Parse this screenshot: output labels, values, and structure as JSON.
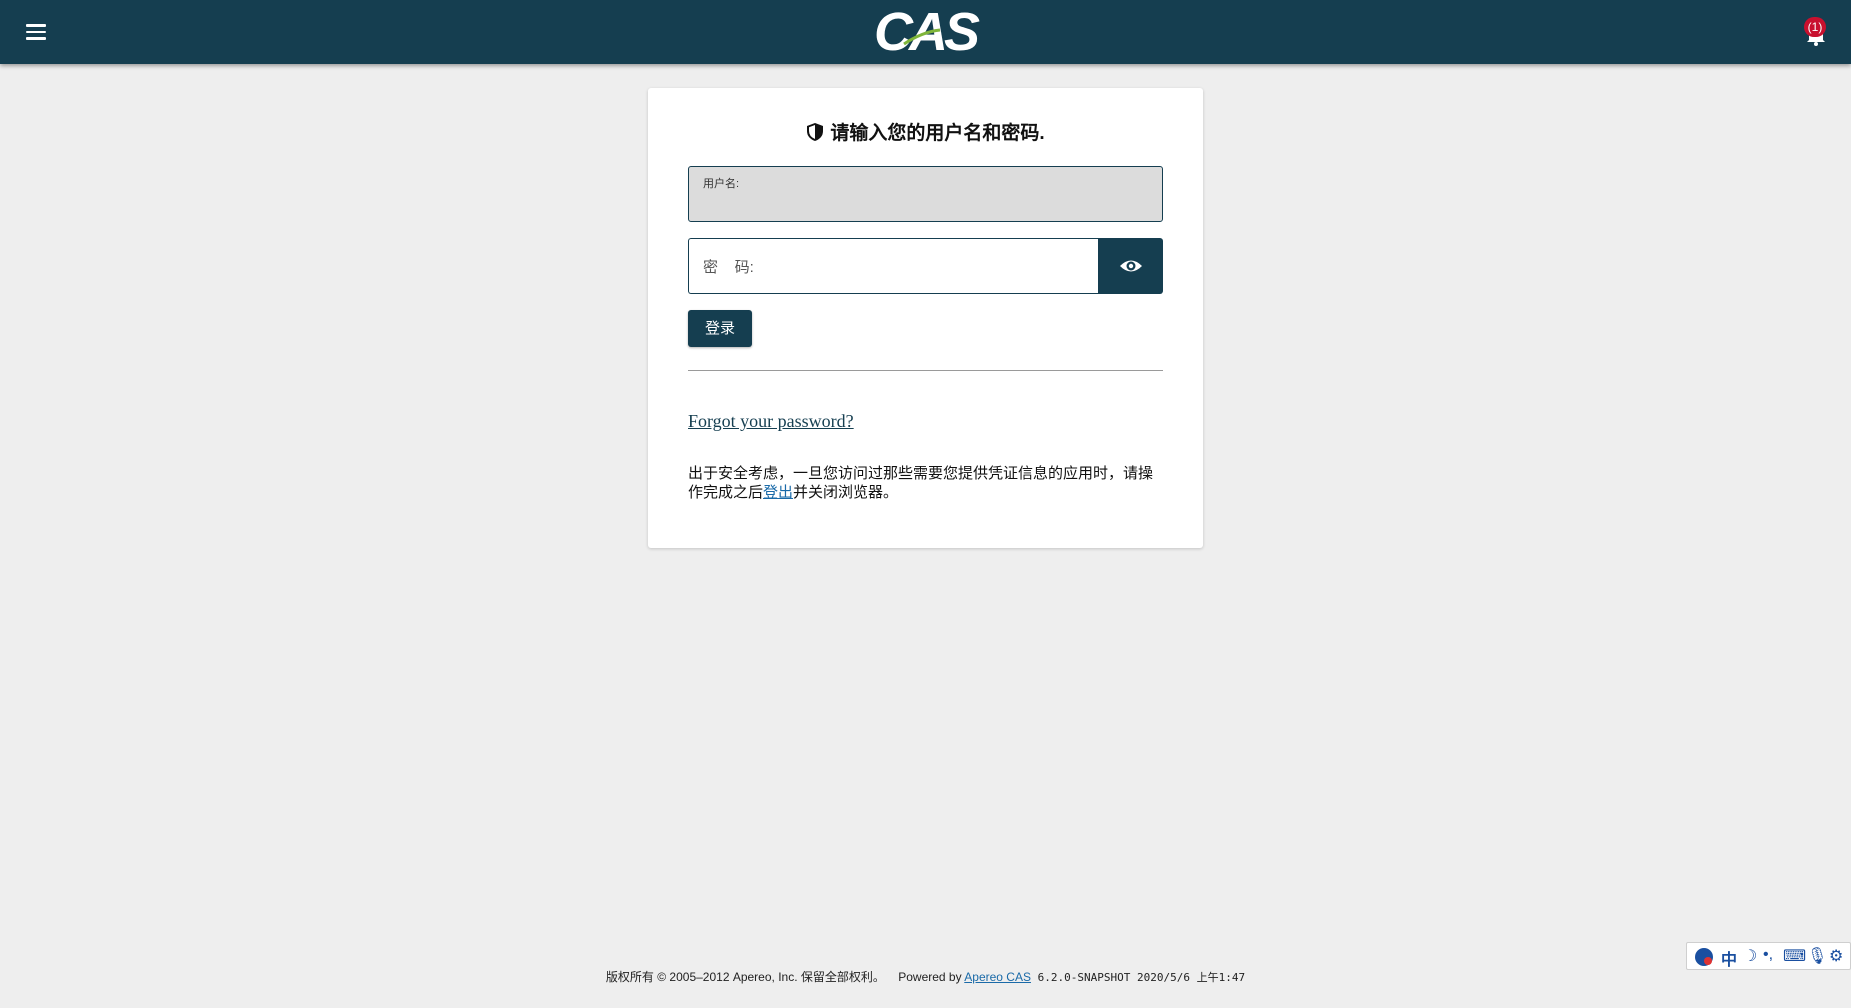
{
  "header": {
    "logo": "CAS",
    "notification_count": "(1)"
  },
  "login": {
    "heading": "请输入您的用户名和密码.",
    "username_label": "用户名:",
    "username_value": "",
    "password_placeholder": "密    码:",
    "submit_label": "登录",
    "forgot_link": "Forgot your password?",
    "notice_before": "出于安全考虑，一旦您访问过那些需要您提供凭证信息的应用时，请操作完成之后",
    "notice_link": "登出",
    "notice_after": "并关闭浏览器。"
  },
  "footer": {
    "copyright": "版权所有 © 2005–2012 Apereo, Inc. 保留全部权利。",
    "powered_by": "Powered by",
    "cas_link": "Apereo CAS",
    "version": "6.2.0-SNAPSHOT 2020/5/6 上午1:47"
  },
  "ime_toolbar": {
    "mode": "中",
    "icons": [
      "ime-logo-icon",
      "moon-icon",
      "punctuation-icon",
      "keyboard-icon",
      "microphone-icon",
      "settings-icon"
    ]
  },
  "colors": {
    "primary": "#153e50",
    "background": "#eeeeee",
    "badge": "#c8102e",
    "link": "#1a6aa8"
  }
}
